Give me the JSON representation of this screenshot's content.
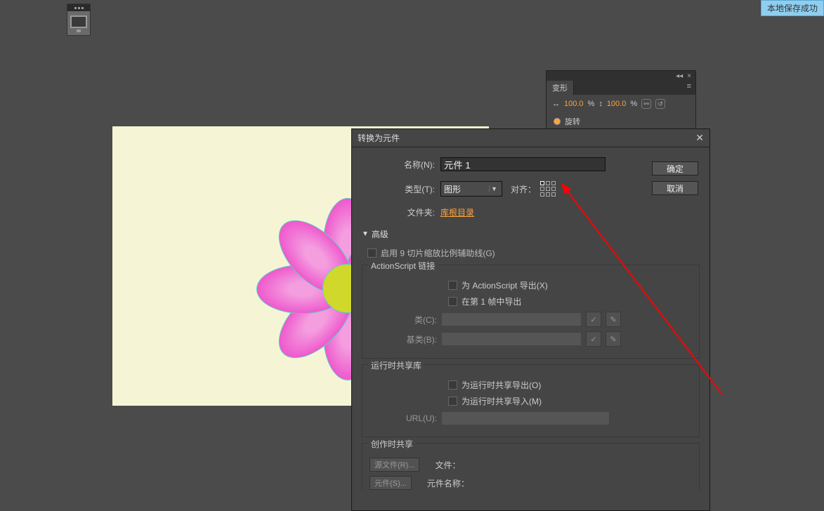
{
  "toast": {
    "text": "本地保存成功"
  },
  "transform_panel": {
    "tab": "变形",
    "width_value": "100.0",
    "height_value": "100.0",
    "percent": "%",
    "rotate_label": "旋转",
    "link_icon": "link-icon",
    "reset_icon": "reset-icon"
  },
  "dialog": {
    "title": "转换为元件",
    "name_label": "名称(N):",
    "name_value": "元件 1",
    "type_label": "类型(T):",
    "type_value": "图形",
    "align_label": "对齐：",
    "folder_label": "文件夹:",
    "folder_value": "库根目录",
    "ok_label": "确定",
    "cancel_label": "取消",
    "advanced_label": "高级",
    "enable9slice_label": "启用 9 切片缩放比例辅助线(G)",
    "as_linking_legend": "ActionScript 链接",
    "export_as_label": "为 ActionScript 导出(X)",
    "export_frame1_label": "在第 1 帧中导出",
    "class_label": "类(C):",
    "baseclass_label": "基类(B):",
    "runtime_legend": "运行时共享库",
    "runtime_export_label": "为运行时共享导出(O)",
    "runtime_import_label": "为运行时共享导入(M)",
    "url_label": "URL(U):",
    "author_legend": "创作时共享",
    "source_btn": "源文件(R)...",
    "file_label": "文件：",
    "symbol_btn": "元件(S)...",
    "symbol_name_label": "元件名称："
  }
}
